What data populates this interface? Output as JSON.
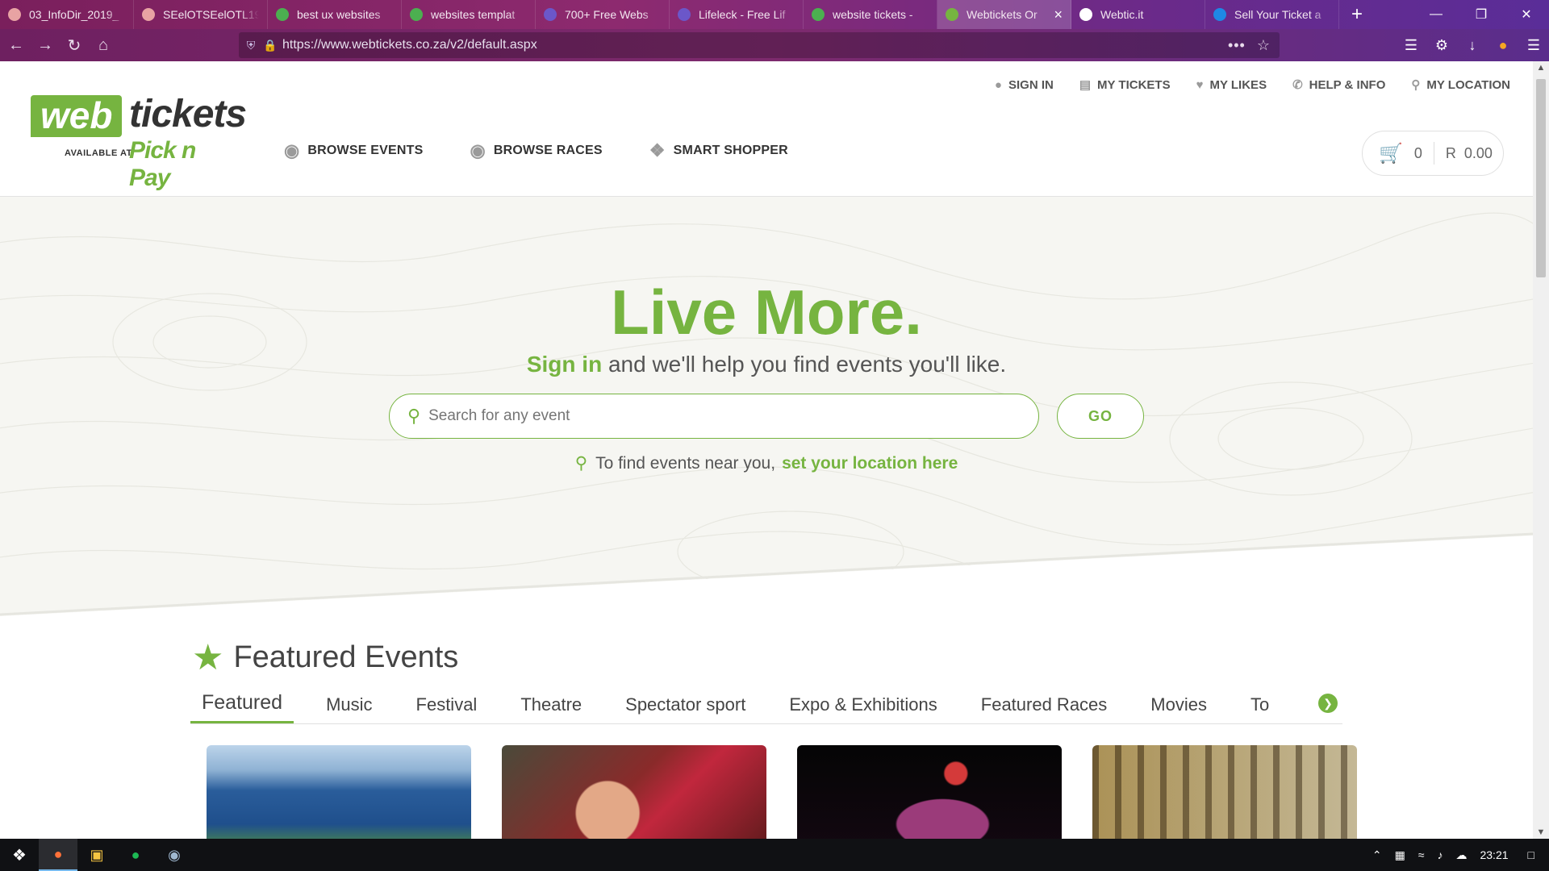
{
  "browser": {
    "tabs": [
      {
        "title": "03_InfoDir_2019_",
        "color": "#e8a3a3",
        "active": false
      },
      {
        "title": "SEelOTSEelOTL19",
        "color": "#e8a3a3",
        "active": false
      },
      {
        "title": "best ux websites",
        "color": "#4caf50",
        "active": false
      },
      {
        "title": "websites templat",
        "color": "#4caf50",
        "active": false
      },
      {
        "title": "700+ Free Webs",
        "color": "#6b57c9",
        "active": false
      },
      {
        "title": "Lifeleck - Free Lif",
        "color": "#6b57c9",
        "active": false
      },
      {
        "title": "website tickets -",
        "color": "#4caf50",
        "active": false
      },
      {
        "title": "Webtickets Or",
        "color": "#76b440",
        "active": true
      },
      {
        "title": "Webtic.it",
        "color": "#ffffff",
        "active": false
      },
      {
        "title": "Sell Your Ticket a",
        "color": "#1e88e5",
        "active": false
      }
    ],
    "url": "https://www.webtickets.co.za/v2/default.aspx"
  },
  "header": {
    "logo_web": "web",
    "logo_tickets": "tickets",
    "logo_available": "AVAILABLE AT",
    "logo_pnp": "Pick n Pay",
    "top_nav": [
      {
        "label": "SIGN IN",
        "icon": "user-icon"
      },
      {
        "label": "MY TICKETS",
        "icon": "ticket-icon"
      },
      {
        "label": "MY LIKES",
        "icon": "heart-icon"
      },
      {
        "label": "HELP & INFO",
        "icon": "phone-icon"
      },
      {
        "label": "MY LOCATION",
        "icon": "location-pin-icon"
      }
    ],
    "main_nav": [
      {
        "label": "BROWSE EVENTS",
        "icon": "binoculars-icon"
      },
      {
        "label": "BROWSE RACES",
        "icon": "binoculars-icon"
      },
      {
        "label": "SMART SHOPPER",
        "icon": "tags-icon"
      }
    ],
    "cart": {
      "count": "0",
      "total": "R  0.00"
    }
  },
  "hero": {
    "title": "Live More.",
    "sub_link": "Sign in",
    "sub_text": " and we'll help you find events you'll like.",
    "search_placeholder": "Search for any event",
    "go_label": "GO",
    "location_text": "To find events near you,",
    "location_link": "set your location here"
  },
  "featured": {
    "title": "Featured Events",
    "categories": [
      "Featured",
      "Music",
      "Festival",
      "Theatre",
      "Spectator sport",
      "Expo & Exhibitions",
      "Featured Races",
      "Movies",
      "To"
    ],
    "active_category": "Featured"
  },
  "taskbar": {
    "time": "23:21"
  },
  "colors": {
    "brand_green": "#76b440",
    "browser_purple": "#7a1f5c"
  }
}
